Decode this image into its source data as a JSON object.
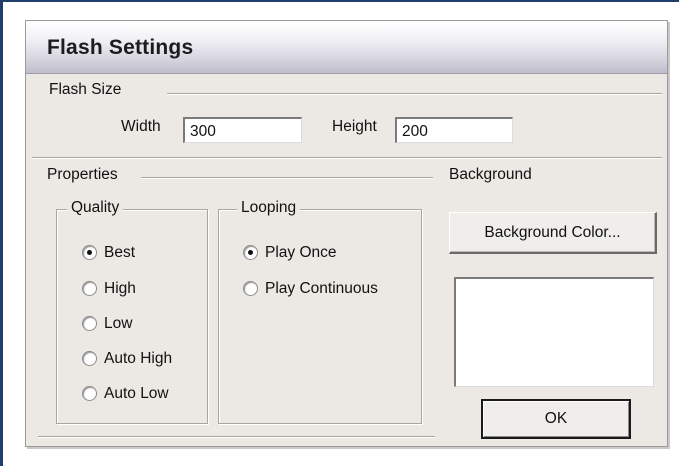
{
  "dialog": {
    "title": "Flash Settings",
    "flash_size": {
      "label": "Flash Size",
      "width_label": "Width",
      "width_value": "300",
      "height_label": "Height",
      "height_value": "200"
    },
    "properties": {
      "label": "Properties",
      "quality": {
        "label": "Quality",
        "options": [
          "Best",
          "High",
          "Low",
          "Auto High",
          "Auto Low"
        ],
        "selected": "Best"
      },
      "looping": {
        "label": "Looping",
        "options": [
          "Play Once",
          "Play Continuous"
        ],
        "selected": "Play Once"
      }
    },
    "background": {
      "label": "Background",
      "color_button_label": "Background Color...",
      "preview_color": "#ffffff"
    },
    "ok_button_label": "OK"
  }
}
